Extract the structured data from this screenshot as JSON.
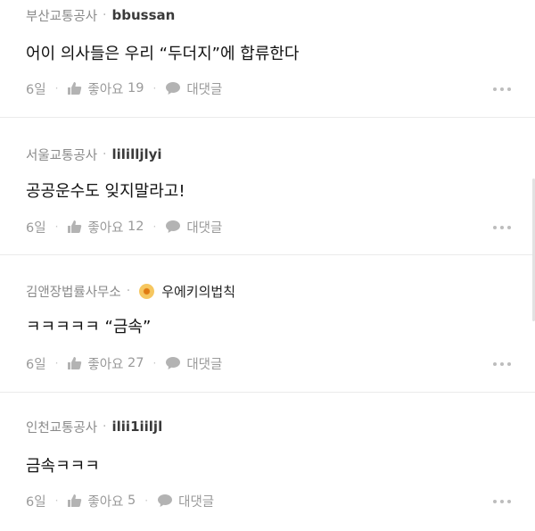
{
  "comments": [
    {
      "org": "부산교통공사",
      "separator": "·",
      "nickname": "bbussan",
      "body": "어이 의사들은 우리 “두더지”에 합류한다",
      "time": "6일",
      "like_label": "좋아요",
      "like_count": "19",
      "reply_label": "대댓글"
    },
    {
      "org": "서울교통공사",
      "separator": "·",
      "nickname": "lililljlyi",
      "body": "공공운수도 잊지말라고!",
      "time": "6일",
      "like_label": "좋아요",
      "like_count": "12",
      "reply_label": "대댓글"
    },
    {
      "org": "김앤장법률사무소",
      "separator": "·",
      "nickname": "우에키의법칙",
      "body": "ㅋㅋㅋㅋㅋ “금속”",
      "time": "6일",
      "like_label": "좋아요",
      "like_count": "27",
      "reply_label": "대댓글"
    },
    {
      "org": "인천교통공사",
      "separator": "·",
      "nickname": "ilii1iiljl",
      "body": "금속ㅋㅋㅋ",
      "time": "6일",
      "like_label": "좋아요",
      "like_count": "5",
      "reply_label": "대댓글"
    }
  ],
  "meta_separator": "·",
  "icons": {
    "like": "thumbs-up-icon",
    "reply": "speech-bubble-icon",
    "more": "more-options-icon",
    "badge": "medal-badge-icon"
  },
  "colors": {
    "meta_text": "#9a9a9a",
    "org_text": "#8a8a8a",
    "divider": "#ebebeb",
    "badge": "#f6c760"
  }
}
